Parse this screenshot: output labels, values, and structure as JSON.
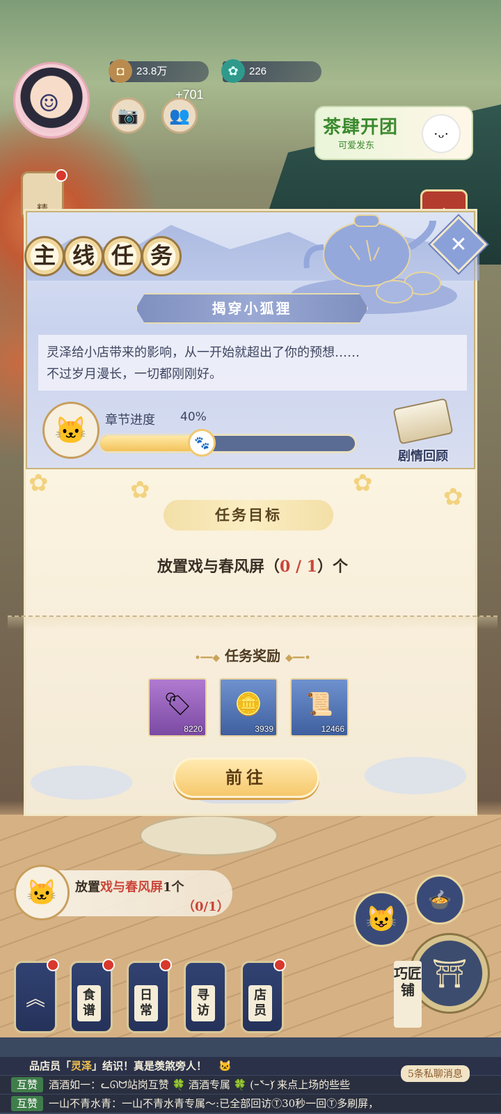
{
  "hud": {
    "coins": "23.8万",
    "gems": "226",
    "plus_count": "+701",
    "event_title": "茶肆开团",
    "event_sub": "可爱发东",
    "side_btn_label": "精"
  },
  "dialog": {
    "title_chars": [
      "主",
      "线",
      "任",
      "务"
    ],
    "quest_name": "揭穿小狐狸",
    "description_line1": "灵泽给小店带来的影响，从一开始就超出了你的预想……",
    "description_line2": "不过岁月漫长，一切都刚刚好。",
    "progress_label": "章节进度",
    "progress_value": "40%",
    "progress_fraction": 0.4,
    "review_label": "剧情回顾",
    "objective_header": "任务目标",
    "objective_prefix": "放置戏与春风屏（",
    "objective_count": "0 / 1",
    "objective_suffix": "）个",
    "reward_header": "任务奖励",
    "rewards": [
      {
        "icon": "ticket-icon",
        "qty": "8220",
        "color": "#8e58b4"
      },
      {
        "icon": "copper-coin-icon",
        "qty": "3939",
        "color": "#4f73b0"
      },
      {
        "icon": "scroll-icon",
        "qty": "12466",
        "color": "#4f73b0"
      }
    ],
    "goto_label": "前往"
  },
  "quest_tip": {
    "line1_prefix": "放置",
    "line1_item": "戏与春风屏",
    "line1_suffix": "1个",
    "line2": "（0/1）"
  },
  "bottom_nav": [
    {
      "label": ""
    },
    {
      "label": "食谱"
    },
    {
      "label": "日常"
    },
    {
      "label": "寻访"
    },
    {
      "label": "店员"
    }
  ],
  "smith_label": "巧匠铺",
  "chat": {
    "system_prefix": "品店员「",
    "system_name": "灵泽",
    "system_suffix": "」结识！真是羡煞旁人！",
    "msg1_tag": "互赞",
    "msg1_text": "酒酒如一：ᓚᘏᗢ站岗互赞 🍀 酒酒专属 🍀  (ｰ̀˘ｰ́)  来点上场的些些",
    "msg2_tag": "互赞",
    "msg2_text": "一山不青水青：一山不青水青专属～:已全部回访Ⓣ30秒一回Ⓣ多刷屏，",
    "private_msg": "5条私聊消息"
  },
  "colors": {
    "accent": "#c9463a",
    "panel": "#c9d3ee",
    "gold": "#f6c86c"
  }
}
